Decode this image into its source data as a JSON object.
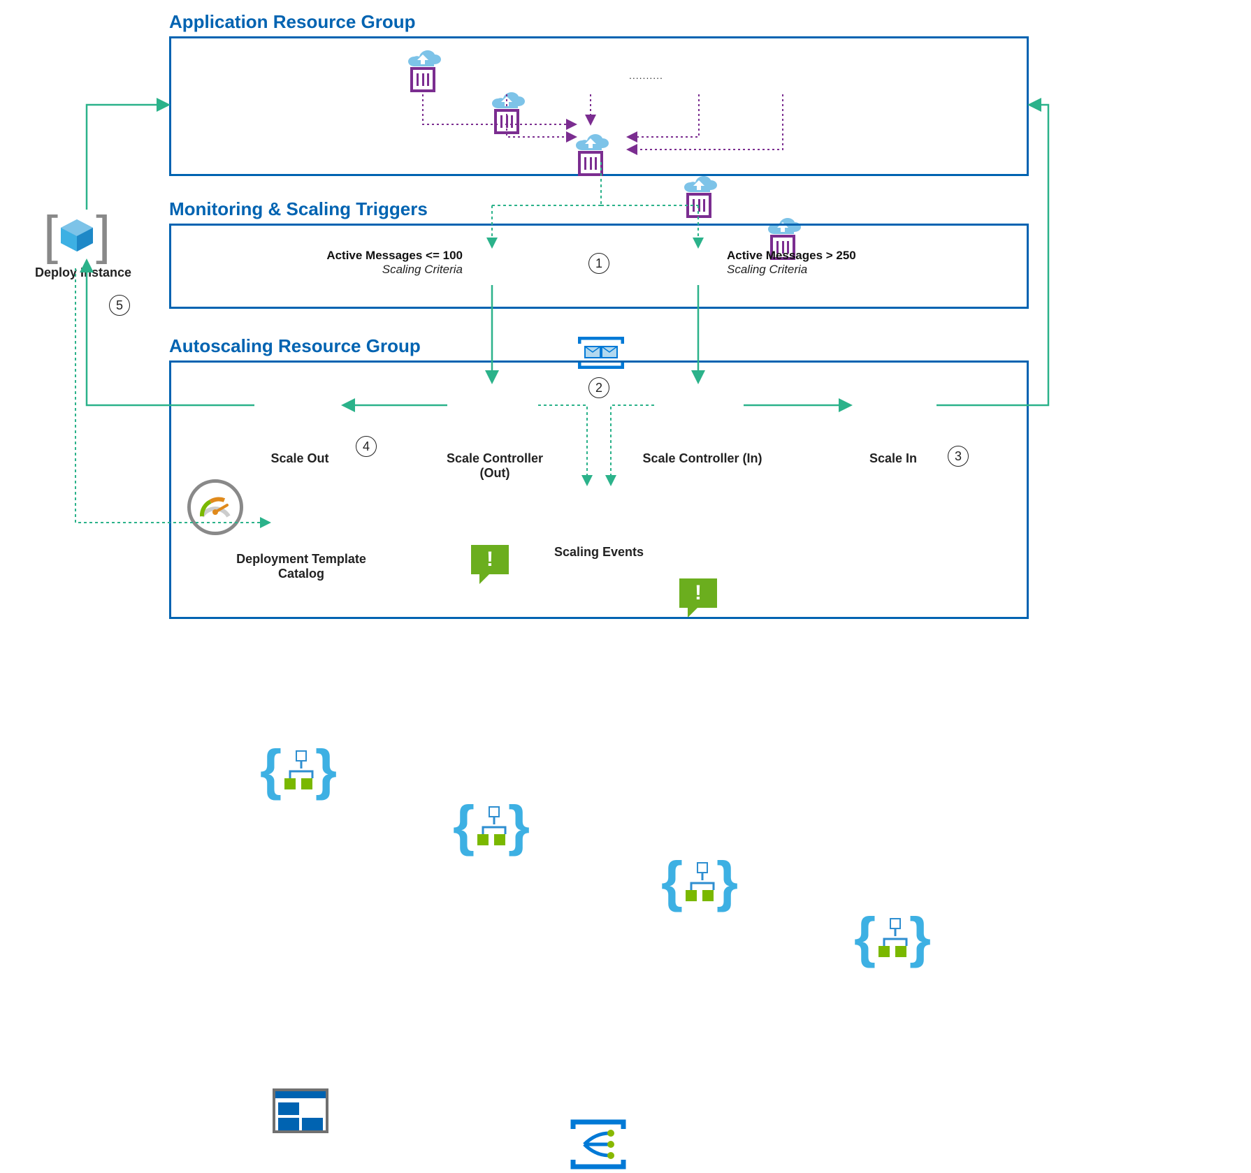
{
  "groups": {
    "app": {
      "title": "Application Resource Group"
    },
    "monitor": {
      "title": "Monitoring & Scaling Triggers"
    },
    "autoscale": {
      "title": "Autoscaling Resource Group"
    }
  },
  "deploy": {
    "label": "Deploy Instance"
  },
  "criteria": {
    "low": {
      "rule": "Active Messages <= 100",
      "sub": "Scaling Criteria"
    },
    "high": {
      "rule": "Active Messages > 250",
      "sub": "Scaling Criteria"
    }
  },
  "logic_apps": {
    "scale_out": "Scale Out",
    "ctrl_out": "Scale Controller (Out)",
    "ctrl_in": "Scale Controller (In)",
    "scale_in": "Scale In"
  },
  "catalog": "Deployment Template Catalog",
  "scaling_events": "Scaling Events",
  "steps": {
    "s1": "1",
    "s2": "2",
    "s3": "3",
    "s4": "4",
    "s5": "5"
  },
  "ellipsis": ".........."
}
